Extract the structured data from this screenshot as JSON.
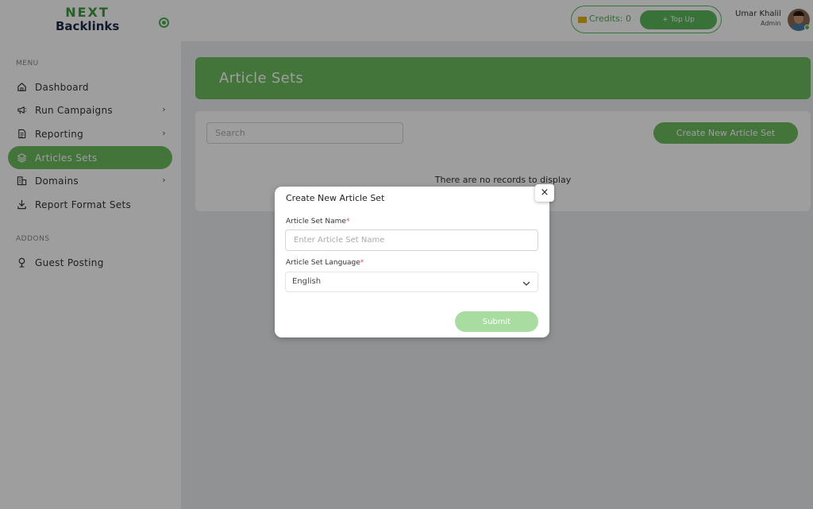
{
  "brand": {
    "logo_line1": "NEXT",
    "logo_line2": "Backlinks"
  },
  "sidebar": {
    "menu_label": "MENU",
    "items": [
      {
        "label": "Dashboard",
        "icon": "home-icon",
        "has_chevron": false,
        "active": false
      },
      {
        "label": "Run Campaigns",
        "icon": "megaphone-icon",
        "has_chevron": true,
        "active": false
      },
      {
        "label": "Reporting",
        "icon": "document-icon",
        "has_chevron": true,
        "active": false
      },
      {
        "label": "Articles Sets",
        "icon": "layers-icon",
        "has_chevron": false,
        "active": true
      },
      {
        "label": "Domains",
        "icon": "buildings-icon",
        "has_chevron": true,
        "active": false
      },
      {
        "label": "Report Format Sets",
        "icon": "download-icon",
        "has_chevron": false,
        "active": false
      }
    ],
    "addons_label": "ADDONS",
    "addons": [
      {
        "label": "Guest Posting",
        "icon": "pin-icon"
      }
    ],
    "chevron_glyph": "›"
  },
  "topbar": {
    "credits_text": "Credits: 0",
    "topup_label": "+ Top Up",
    "user_name": "Umar Khalil",
    "user_role": "Admin"
  },
  "main": {
    "page_title": "Article Sets",
    "search_placeholder": "Search",
    "create_button_label": "Create New Article Set",
    "empty_message": "There are no records to display"
  },
  "modal": {
    "title": "Create New Article Set",
    "close_glyph": "×",
    "name_label": "Article Set Name",
    "required_mark": "*",
    "name_placeholder": "Enter Article Set Name",
    "language_label": "Article Set Language",
    "language_value": "English",
    "submit_label": "Submit"
  },
  "colors": {
    "brand_green": "#6cbb5e",
    "submit_disabled_green": "#a8dca0",
    "required_red": "#d9534f"
  }
}
